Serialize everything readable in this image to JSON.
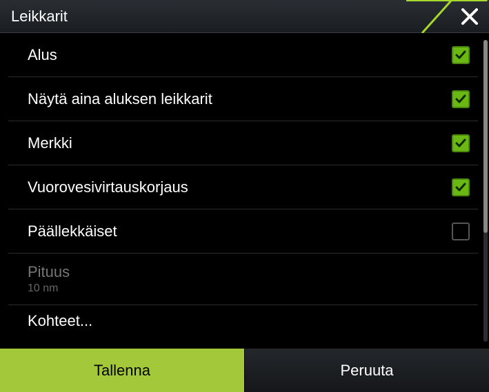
{
  "header": {
    "title": "Leikkarit"
  },
  "items": [
    {
      "label": "Alus",
      "checked": true,
      "hasCheckbox": true
    },
    {
      "label": "Näytä aina aluksen leikkarit",
      "checked": true,
      "hasCheckbox": true
    },
    {
      "label": "Merkki",
      "checked": true,
      "hasCheckbox": true
    },
    {
      "label": "Vuorovesivirtauskorjaus",
      "checked": true,
      "hasCheckbox": true
    },
    {
      "label": "Päällekkäiset",
      "checked": false,
      "hasCheckbox": true
    },
    {
      "label": "Pituus",
      "sub": "10 nm",
      "dim": true,
      "hasCheckbox": false
    },
    {
      "label": "Kohteet...",
      "hasCheckbox": false,
      "cutoff": true
    }
  ],
  "footer": {
    "save": "Tallenna",
    "cancel": "Peruuta"
  }
}
